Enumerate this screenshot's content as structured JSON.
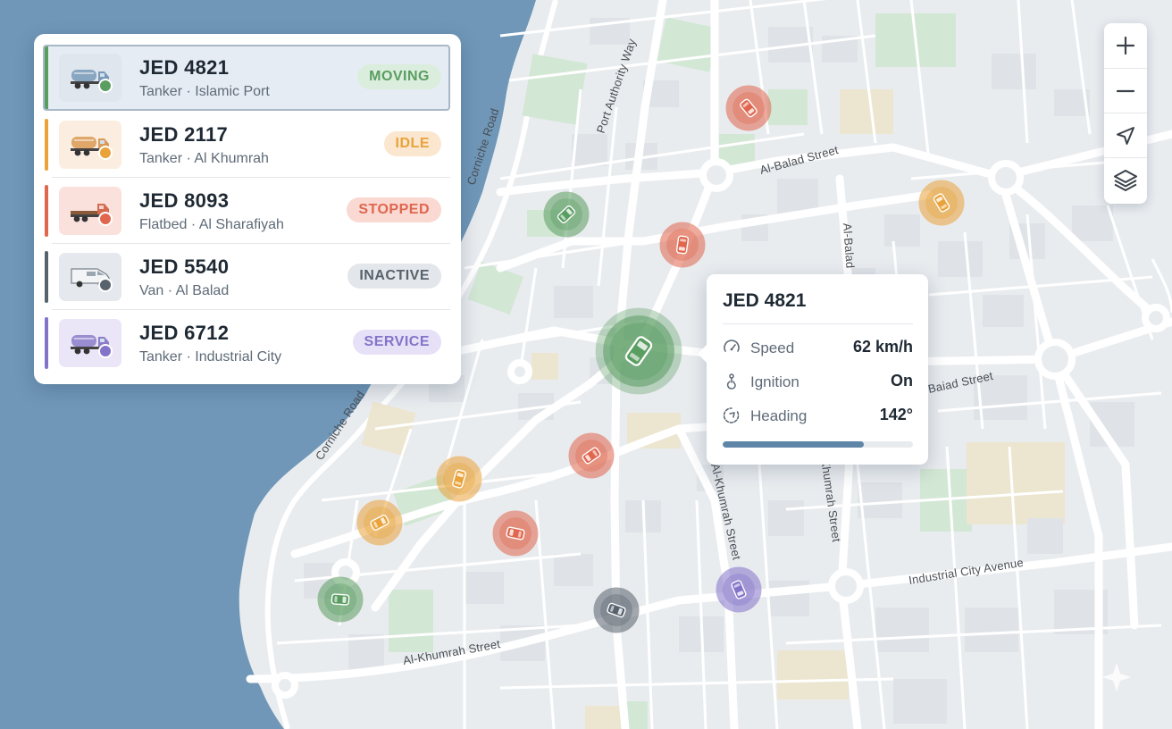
{
  "colors": {
    "water": "#7097b8",
    "land": "#e9ecef",
    "park": "#d3e7d5",
    "sand": "#ece5d0",
    "moving": "#5a9d61",
    "idle": "#e9a33a",
    "stopped": "#e0664e",
    "inactive": "#58626d",
    "service": "#8474c9"
  },
  "streets": {
    "port_authority": "Port Authority Way",
    "corniche_north": "Corniche Road",
    "corniche_south": "Corniche Road",
    "al_balad_north": "Al-Balad Street",
    "al_balad_vertical": "Al-Balad",
    "al_balad_east": "Baiad Street",
    "al_khumrah_1": "Al-Khumrah Street",
    "al_khumrah_2": "Al-Khumrah Street",
    "al_khumrah_south": "Al-Khumrah Street",
    "industrial_city": "Industrial City Avenue"
  },
  "vehicles": [
    {
      "plate": "JED 4821",
      "subtitle": "Tanker · Islamic Port",
      "status": "MOVING",
      "status_key": "moving",
      "icon": "tanker-truck-icon"
    },
    {
      "plate": "JED 2117",
      "subtitle": "Tanker · Al Khumrah",
      "status": "IDLE",
      "status_key": "idle",
      "icon": "tanker-truck-icon"
    },
    {
      "plate": "JED 8093",
      "subtitle": "Flatbed · Al Sharafiyah",
      "status": "STOPPED",
      "status_key": "stopped",
      "icon": "flatbed-truck-icon"
    },
    {
      "plate": "JED 5540",
      "subtitle": "Van · Al Balad",
      "status": "INACTIVE",
      "status_key": "inactive",
      "icon": "van-icon"
    },
    {
      "plate": "JED 6712",
      "subtitle": "Tanker · Industrial City",
      "status": "SERVICE",
      "status_key": "service",
      "icon": "tanker-truck-icon"
    }
  ],
  "map_controls": {
    "zoom_in": "plus-icon",
    "zoom_out": "minus-icon",
    "locate": "navigation-arrow-icon",
    "layers": "layers-icon"
  },
  "map_markers": [
    {
      "id": "JED 4821",
      "status": "moving",
      "selected": true
    },
    {
      "id": "marker-2",
      "status": "moving"
    },
    {
      "id": "marker-3",
      "status": "moving"
    },
    {
      "id": "marker-4",
      "status": "stopped"
    },
    {
      "id": "marker-5",
      "status": "stopped"
    },
    {
      "id": "marker-6",
      "status": "stopped"
    },
    {
      "id": "marker-7",
      "status": "stopped"
    },
    {
      "id": "marker-8",
      "status": "idle"
    },
    {
      "id": "marker-9",
      "status": "idle"
    },
    {
      "id": "marker-10",
      "status": "idle"
    },
    {
      "id": "marker-11",
      "status": "inactive"
    },
    {
      "id": "marker-12",
      "status": "service"
    }
  ],
  "popup": {
    "title": "JED 4821",
    "speed_label": "Speed",
    "speed_value": "62 km/h",
    "ignition_label": "Ignition",
    "ignition_value": "On",
    "heading_label": "Heading",
    "heading_value": "142°",
    "progress": 0.74
  }
}
